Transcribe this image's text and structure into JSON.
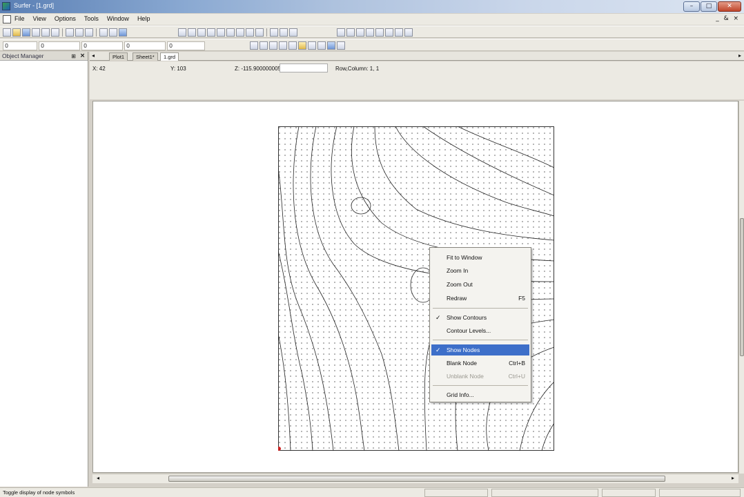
{
  "window": {
    "title": "Surfer - [1.grd]",
    "minimize": "–",
    "maximize": "□",
    "close": "✕"
  },
  "menu": {
    "items": [
      "File",
      "View",
      "Options",
      "Tools",
      "Window",
      "Help"
    ],
    "mdi_controls": "_ & ×"
  },
  "toolbar2": {
    "fields": [
      "0",
      "0",
      "0",
      "0",
      "0"
    ]
  },
  "object_manager": {
    "title": "Object Manager",
    "pin": "⊞",
    "close": "×"
  },
  "tabs": {
    "items": [
      "Plot1",
      "Sheet1*",
      "1.grd"
    ],
    "active_index": 2
  },
  "coords": {
    "x": "X: 42",
    "y": "Y: 103",
    "z": "Z: -115.90000000566",
    "rowcol": "Row,Column: 1, 1"
  },
  "context_menu": {
    "fit_to_window": "Fit to Window",
    "zoom_in": "Zoom In",
    "zoom_out": "Zoom Out",
    "redraw": "Redraw",
    "redraw_shortcut": "F5",
    "show_contours": "Show Contours",
    "contour_levels": "Contour Levels...",
    "show_nodes": "Show Nodes",
    "blank_node": "Blank Node",
    "blank_node_shortcut": "Ctrl+B",
    "unblank_node": "Unblank Node",
    "unblank_node_shortcut": "Ctrl+U",
    "grid_info": "Grid Info...",
    "check": "✓"
  },
  "status": {
    "text": "Toggle display of node symbols"
  },
  "colors": {
    "highlight": "#3d6fc9",
    "node_marker": "#cc2222"
  }
}
